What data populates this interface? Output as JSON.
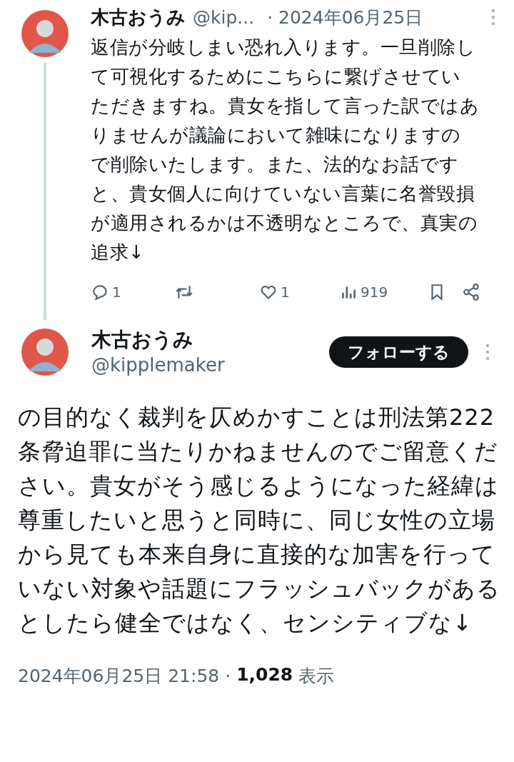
{
  "reply_tweet": {
    "author": {
      "name": "木古おうみ",
      "handle": "@kip...",
      "date": "· 2024年06月25日"
    },
    "text": "返信が分岐しまい恐れ入ります。一旦削除して可視化するためにこちらに繋げさせていただきますね。貴女を指して言った訳ではありませんが議論において雑味になりますので削除いたします。また、法的なお話ですと、貴女個人に向けていない言葉に名誉毀損が適用されるかは不透明なところで、真実の追求↓",
    "actions": [
      {
        "kind": "reply",
        "count": "1"
      },
      {
        "kind": "repost"
      },
      {
        "kind": "like",
        "count": "1"
      },
      {
        "kind": "views",
        "count": "919"
      },
      {
        "kind": "bookmark"
      },
      {
        "kind": "share"
      }
    ]
  },
  "main_tweet": {
    "author": {
      "name": "木古おうみ",
      "handle": "@kipplemaker"
    },
    "follow_button": "フォローする",
    "text": "の目的なく裁判を仄めかすことは刑法第222条脅迫罪に当たりかねませんのでご留意ください。貴女がそう感じるようになった経緯は尊重したいと思うと同時に、同じ女性の立場から見ても本来自身に直接的な加害を行っていない対象や話題にフラッシュバックがあるとしたら健全ではなく、センシティブな↓",
    "timestamp": "2024年06月25日 21:58 ·",
    "views_count": "1,028",
    "views_label": "表示"
  }
}
